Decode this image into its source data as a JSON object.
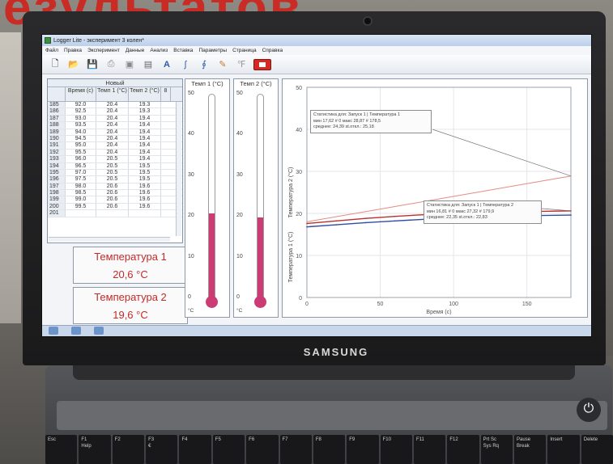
{
  "background_title": "езультатов",
  "laptop_brand": "SAMSUNG",
  "window_title": "Logger Lite - эксперимент 3 колен*",
  "menu": [
    "Файл",
    "Правка",
    "Эксперимент",
    "Данные",
    "Анализ",
    "Вставка",
    "Параметры",
    "Страница",
    "Справка"
  ],
  "table": {
    "title": "Новый",
    "headers": [
      "Время (с)",
      "Темп 1 (°C)",
      "Темп 2 (°C)",
      "8"
    ],
    "rows": [
      [
        "185",
        "92.0",
        "20.4",
        "19.3"
      ],
      [
        "186",
        "92.5",
        "20.4",
        "19.3"
      ],
      [
        "187",
        "93.0",
        "20.4",
        "19.4"
      ],
      [
        "188",
        "93.5",
        "20.4",
        "19.4"
      ],
      [
        "189",
        "94.0",
        "20.4",
        "19.4"
      ],
      [
        "190",
        "94.5",
        "20.4",
        "19.4"
      ],
      [
        "191",
        "95.0",
        "20.4",
        "19.4"
      ],
      [
        "192",
        "95.5",
        "20.4",
        "19.4"
      ],
      [
        "193",
        "96.0",
        "20.5",
        "19.4"
      ],
      [
        "194",
        "96.5",
        "20.5",
        "19.5"
      ],
      [
        "195",
        "97.0",
        "20.5",
        "19.5"
      ],
      [
        "196",
        "97.5",
        "20.5",
        "19.5"
      ],
      [
        "197",
        "98.0",
        "20.6",
        "19.6"
      ],
      [
        "198",
        "98.5",
        "20.6",
        "19.6"
      ],
      [
        "199",
        "99.0",
        "20.6",
        "19.6"
      ],
      [
        "200",
        "99.5",
        "20.6",
        "19.6"
      ],
      [
        "201",
        "",
        "",
        ""
      ]
    ]
  },
  "meters": [
    {
      "name": "Температура 1",
      "value": "20,6 °C"
    },
    {
      "name": "Температура 2",
      "value": "19,6 °C"
    }
  ],
  "gauges": [
    {
      "title": "Темп 1 (°C)",
      "ticks": [
        "50",
        "40",
        "30",
        "20",
        "10",
        "0"
      ],
      "unit": "°C",
      "level": 20.6
    },
    {
      "title": "Темп 2 (°C)",
      "ticks": [
        "50",
        "40",
        "30",
        "20",
        "10",
        "0"
      ],
      "unit": "°C",
      "level": 19.6
    }
  ],
  "graph": {
    "y_ticks": [
      "50",
      "40",
      "30",
      "20",
      "10",
      "0"
    ],
    "x_ticks": [
      "0",
      "50",
      "100",
      "150"
    ],
    "ylabel": "Температура 2 (°C)",
    "ylabel2": "Температура 1 (°C)",
    "xlabel": "Время (с)",
    "stats1": {
      "line1": "Статистика для: Запуск 1 | Температура 1",
      "line2": "мин 17,62 # 0  макс 28,87 # 178,5",
      "line3": "среднее: 24,39  st.откл.: 25,18"
    },
    "stats2": {
      "line1": "Статистика для: Запуск 1 | Температура 2",
      "line2": "мин 16,81 # 0  макс 27,32 # 179,9",
      "line3": "среднее: 22,35  st.откл.: 22,83"
    },
    "colors": {
      "series1": "#b9302f",
      "series2": "#2c4fa2",
      "trend": "#e28a80"
    }
  },
  "chart_data": {
    "type": "line",
    "xlabel": "Время (с)",
    "ylabel": "Температура 2 (°C)",
    "xlim": [
      0,
      180
    ],
    "ylim": [
      0,
      50
    ],
    "x": [
      0,
      20,
      40,
      60,
      80,
      100,
      120,
      140,
      160,
      180
    ],
    "series": [
      {
        "name": "Температура 1",
        "values": [
          17.6,
          18.2,
          18.8,
          19.3,
          19.7,
          20.0,
          20.2,
          20.4,
          20.5,
          20.6
        ]
      },
      {
        "name": "Температура 2",
        "values": [
          16.8,
          17.3,
          17.8,
          18.2,
          18.6,
          18.9,
          19.1,
          19.3,
          19.5,
          19.6
        ]
      }
    ],
    "trend": {
      "x": [
        0,
        180
      ],
      "y": [
        18.0,
        28.9
      ]
    }
  }
}
